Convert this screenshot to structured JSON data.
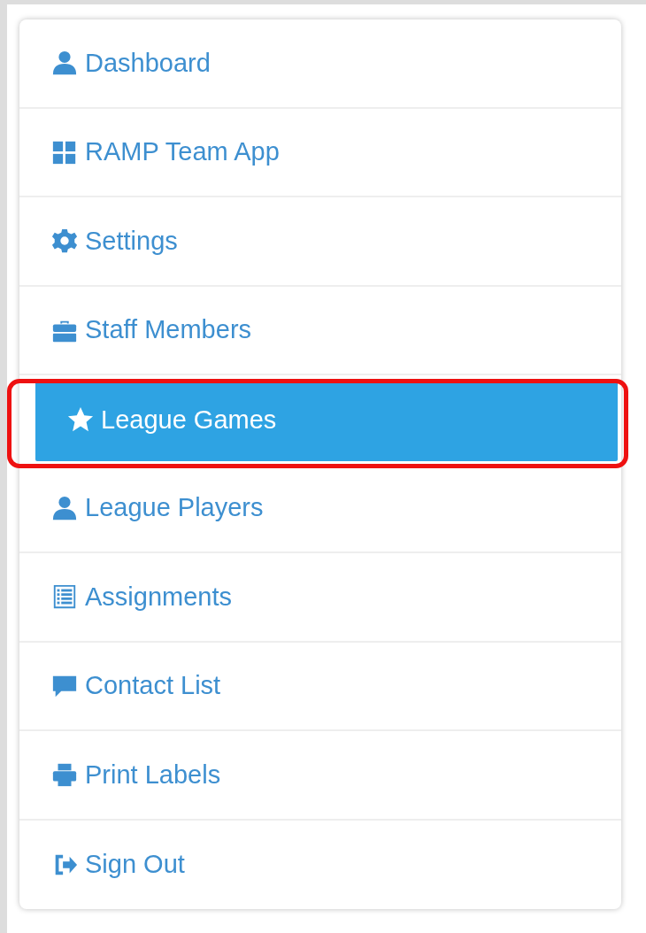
{
  "menu": [
    {
      "label": "Dashboard",
      "selected": false
    },
    {
      "label": "RAMP Team App",
      "selected": false
    },
    {
      "label": "Settings",
      "selected": false
    },
    {
      "label": "Staff Members",
      "selected": false
    },
    {
      "label": "League Games",
      "selected": true
    },
    {
      "label": "League Players",
      "selected": false
    },
    {
      "label": "Assignments",
      "selected": false
    },
    {
      "label": "Contact List",
      "selected": false
    },
    {
      "label": "Print Labels",
      "selected": false
    },
    {
      "label": "Sign Out",
      "selected": false
    }
  ]
}
